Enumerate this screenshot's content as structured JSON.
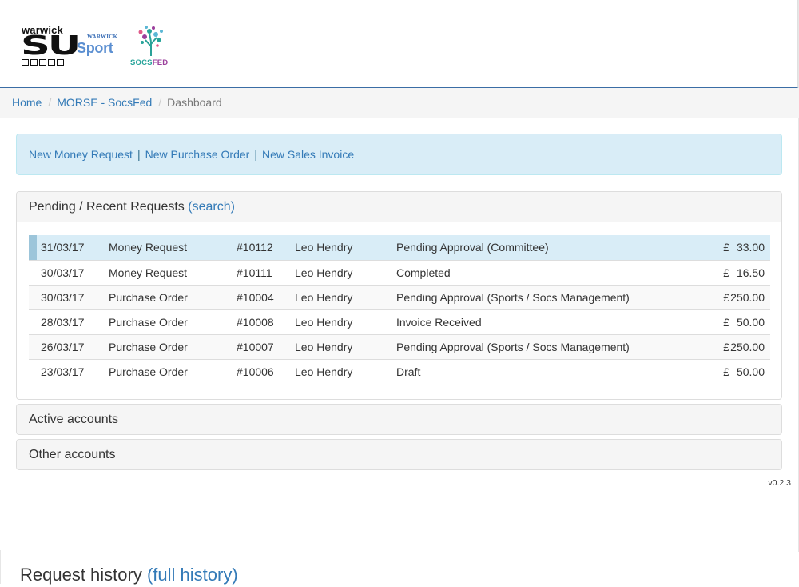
{
  "logos": {
    "su_word": "warwick",
    "su_mark": "SU",
    "sport_small": "WARWICK",
    "sport_big": "Sport",
    "socsfed_socs": "SOCS",
    "socsfed_fed": "FED"
  },
  "breadcrumb": {
    "home": "Home",
    "org": "MORSE - SocsFed",
    "current": "Dashboard",
    "separator": "/"
  },
  "actions": {
    "new_money_request": "New Money Request",
    "new_purchase_order": "New Purchase Order",
    "new_sales_invoice": "New Sales Invoice",
    "separator": "|"
  },
  "pending_panel": {
    "title": "Pending / Recent Requests",
    "search_link": "(search)",
    "rows": [
      {
        "date": "31/03/17",
        "type": "Money Request",
        "ref": "#10112",
        "name": "Leo Hendry",
        "status": "Pending Approval (Committee)",
        "currency": "£",
        "amount": "33.00",
        "highlight": true
      },
      {
        "date": "30/03/17",
        "type": "Money Request",
        "ref": "#10111",
        "name": "Leo Hendry",
        "status": "Completed",
        "currency": "£",
        "amount": "16.50",
        "highlight": false
      },
      {
        "date": "30/03/17",
        "type": "Purchase Order",
        "ref": "#10004",
        "name": "Leo Hendry",
        "status": "Pending Approval (Sports / Socs Management)",
        "currency": "£",
        "amount": "250.00",
        "highlight": false
      },
      {
        "date": "28/03/17",
        "type": "Purchase Order",
        "ref": "#10008",
        "name": "Leo Hendry",
        "status": "Invoice Received",
        "currency": "£",
        "amount": "50.00",
        "highlight": false
      },
      {
        "date": "26/03/17",
        "type": "Purchase Order",
        "ref": "#10007",
        "name": "Leo Hendry",
        "status": "Pending Approval (Sports / Socs Management)",
        "currency": "£",
        "amount": "250.00",
        "highlight": false
      },
      {
        "date": "23/03/17",
        "type": "Purchase Order",
        "ref": "#10006",
        "name": "Leo Hendry",
        "status": "Draft",
        "currency": "£",
        "amount": "50.00",
        "highlight": false
      }
    ]
  },
  "active_accounts": {
    "title": "Active accounts"
  },
  "other_accounts": {
    "title": "Other accounts"
  },
  "version": "v0.2.3",
  "history": {
    "title": "Request history",
    "link": "(full history)"
  },
  "colors": {
    "link": "#337ab7",
    "info_bg": "#d9edf7",
    "header_rule": "#3a6da5"
  }
}
